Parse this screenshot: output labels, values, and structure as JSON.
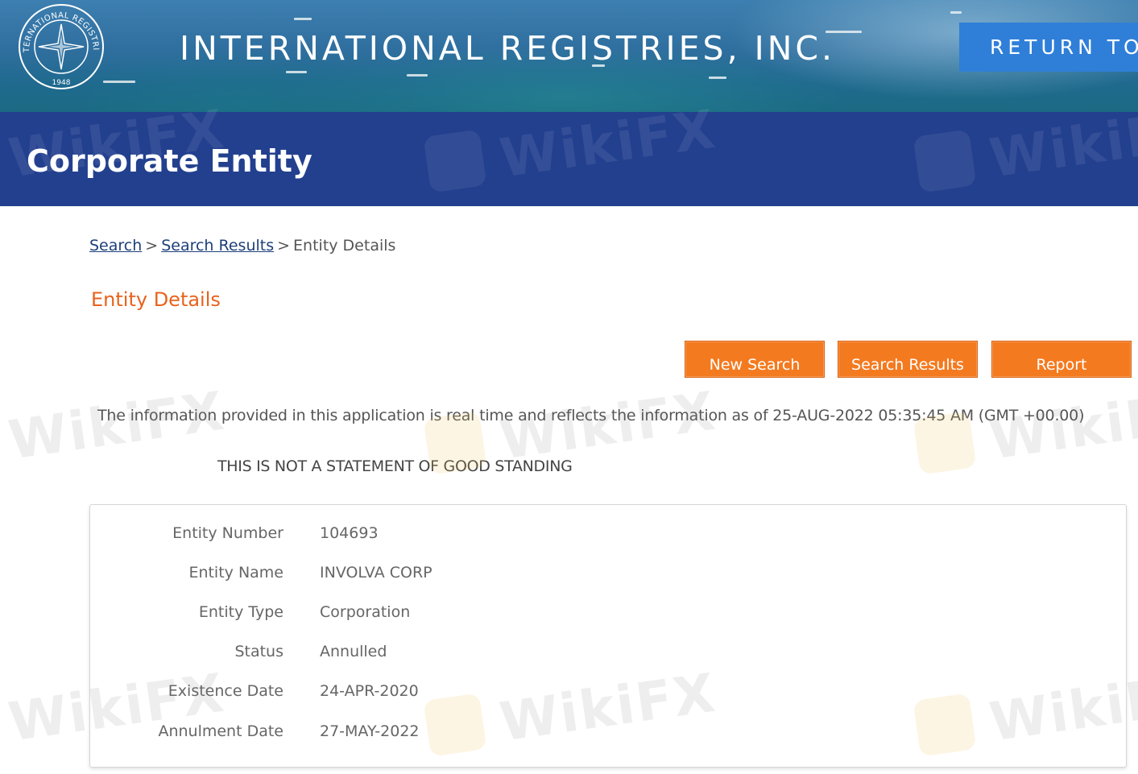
{
  "header": {
    "seal": {
      "top_text": "INTERNATIONAL REGISTRIES",
      "year": "1948"
    },
    "title": "INTERNATIONAL REGISTRIES, INC.",
    "return_button_label": "RETURN TO"
  },
  "page": {
    "title": "Corporate Entity"
  },
  "breadcrumb": {
    "search": "Search",
    "separator_1": ">",
    "search_results": "Search Results",
    "separator_2": ">",
    "current": "Entity Details"
  },
  "section_heading": "Entity Details",
  "buttons": {
    "new_search": "New Search",
    "search_results": "Search Results",
    "report": "Report"
  },
  "info_text": "The information provided in this application is real time and reflects the information as of 25-AUG-2022 05:35:45 AM (GMT +00.00)",
  "notice": "THIS IS NOT A STATEMENT OF GOOD STANDING",
  "details": [
    {
      "label": "Entity Number",
      "value": "104693"
    },
    {
      "label": "Entity Name",
      "value": "INVOLVA CORP"
    },
    {
      "label": "Entity Type",
      "value": "Corporation"
    },
    {
      "label": "Status",
      "value": "Annulled"
    },
    {
      "label": "Existence Date",
      "value": "24-APR-2020"
    },
    {
      "label": "Annulment Date",
      "value": "27-MAY-2022"
    }
  ],
  "watermark": "WikiFX",
  "colors": {
    "title_bar": "#23408f",
    "accent_orange": "#f47a1f",
    "heading_orange": "#e8621c",
    "return_button": "#2f7fd8",
    "link": "#1d3f7a"
  }
}
